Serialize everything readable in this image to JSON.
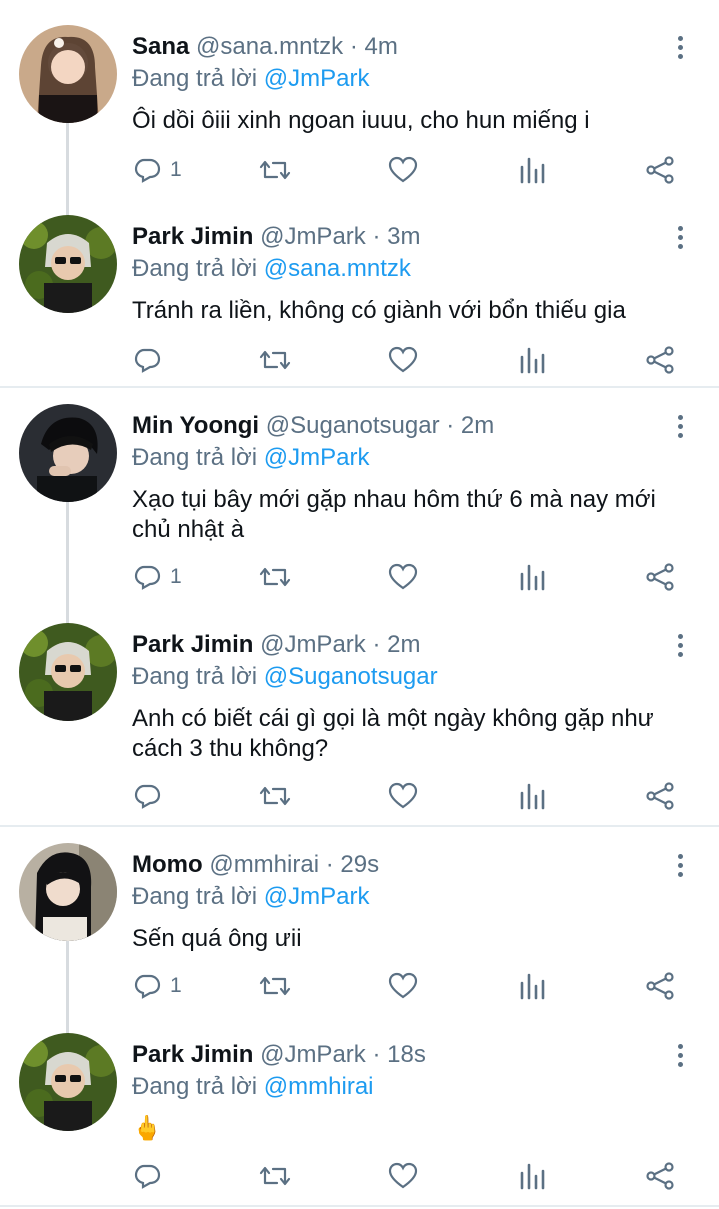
{
  "reply_prefix": "Đang trả lời",
  "tweets": [
    {
      "name": "Sana",
      "handle": "@sana.mntzk",
      "dot": "·",
      "time": "4m",
      "mention": "@JmPark",
      "text": "Ôi dồi ôiii xinh ngoan iuuu, cho hun miếng i",
      "reply_count": "1"
    },
    {
      "name": "Park Jimin",
      "handle": "@JmPark",
      "dot": "·",
      "time": "3m",
      "mention": "@sana.mntzk",
      "text": "Tránh ra liền, không có giành với bổn thiếu gia",
      "reply_count": ""
    },
    {
      "name": "Min Yoongi",
      "handle": "@Suganotsugar",
      "dot": "·",
      "time": "2m",
      "mention": "@JmPark",
      "text": "Xạo tụi bây mới gặp nhau hôm thứ 6 mà nay mới chủ nhật à",
      "reply_count": "1"
    },
    {
      "name": "Park Jimin",
      "handle": "@JmPark",
      "dot": "·",
      "time": "2m",
      "mention": "@Suganotsugar",
      "text": "Anh có biết cái gì gọi là một ngày không gặp như cách 3 thu không?",
      "reply_count": ""
    },
    {
      "name": "Momo",
      "handle": "@mmhirai",
      "dot": "·",
      "time": "29s",
      "mention": "@JmPark",
      "text": "Sến quá ông ưii",
      "reply_count": "1"
    },
    {
      "name": "Park Jimin",
      "handle": "@JmPark",
      "dot": "·",
      "time": "18s",
      "mention": "@mmhirai",
      "text": "🖕",
      "reply_count": ""
    }
  ],
  "icons": {
    "reply": "reply-icon",
    "retweet": "retweet-icon",
    "like": "heart-icon",
    "stats": "stats-icon",
    "share": "share-icon",
    "more": "more-options-icon"
  },
  "colors": {
    "mention": "#1d9bf0",
    "secondary": "#5b7083",
    "divider": "#e6ecf0",
    "thread_line": "#d7dbdf"
  }
}
